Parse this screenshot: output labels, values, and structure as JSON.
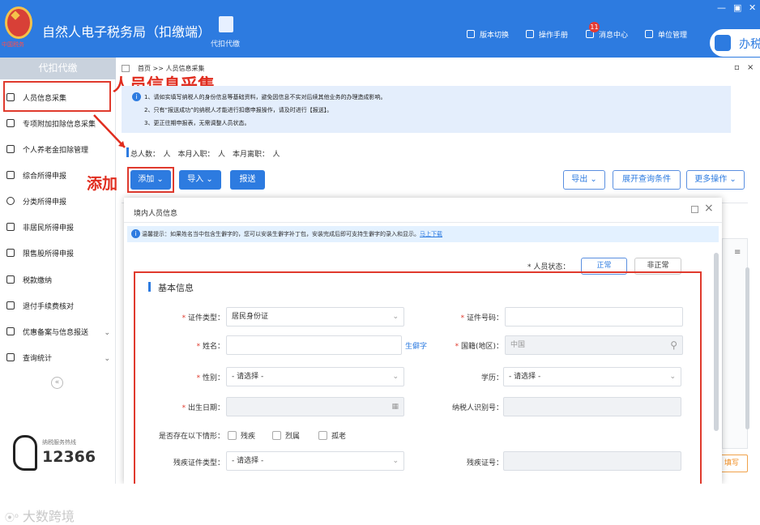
{
  "app": {
    "title": "自然人电子税务局（扣缴端）",
    "emblem_subtitle": "中国税务",
    "agent_tab": "代扣代缴",
    "nav": [
      "版本切换",
      "操作手册",
      "消息中心",
      "单位管理"
    ],
    "message_badge": "11",
    "window_controls": [
      "—",
      "▣",
      "✕"
    ],
    "office_label": "办税"
  },
  "sidebar": {
    "header": "代扣代缴",
    "items": [
      {
        "label": "人员信息采集",
        "icon": "person-icon"
      },
      {
        "label": "专项附加扣除信息采集",
        "icon": "list-icon"
      },
      {
        "label": "个人养老金扣除管理",
        "icon": "doc-icon"
      },
      {
        "label": "综合所得申报",
        "icon": "layers-icon"
      },
      {
        "label": "分类所得申报",
        "icon": "clock-icon"
      },
      {
        "label": "非居民所得申报",
        "icon": "user-icon"
      },
      {
        "label": "限售股所得申报",
        "icon": "bar-icon"
      },
      {
        "label": "税款缴纳",
        "icon": "folder-icon"
      },
      {
        "label": "退付手续费核对",
        "icon": "report-icon"
      },
      {
        "label": "优惠备案与信息报送",
        "icon": "file-icon"
      },
      {
        "label": "查询统计",
        "icon": "query-icon"
      }
    ],
    "collapse": "«",
    "hotline_label": "纳税服务热线",
    "hotline": "12366"
  },
  "main": {
    "breadcrumb": "首页 >> 人员信息采集",
    "controls": [
      "▫",
      "×"
    ],
    "notices": [
      "1、请如实填写纳税人的身份信息等基础资料，避免因信息不实对后续其他业务的办理造成影响。",
      "2、只有“报送成功”的纳税人才能进行扣缴申报操作，请及时进行【报送】。",
      "3、更正往期申报表，无需调整人员状态。"
    ],
    "summary": "总人数：　人　本月入职：　人　本月离职：　人",
    "buttons": {
      "add": "添加",
      "import": "导入",
      "submit": "报送",
      "export": "导出",
      "expand_query": "展开查询条件",
      "more": "更多操作"
    },
    "right_edge": [
      "≡",
      "填写"
    ]
  },
  "annotations": {
    "title": "人员信息采集",
    "add": "添加"
  },
  "modal": {
    "title": "境内人员信息",
    "tip": "温馨提示：如果姓名当中包含生僻字的，您可以安装生僻字补丁包，安装完成后即可支持生僻字的录入和显示。",
    "tip_link": "马上下载",
    "status_label": "* 人员状态：",
    "status_options": [
      "正常",
      "非正常"
    ],
    "section": "基本信息",
    "fields": {
      "id_type": {
        "label": "证件类型：",
        "value": "居民身份证"
      },
      "id_number": {
        "label": "证件号码：",
        "value": ""
      },
      "name": {
        "label": "姓名：",
        "value": ""
      },
      "rare_char": "生僻字",
      "nationality": {
        "label": "国籍(地区)：",
        "value": "中国"
      },
      "gender": {
        "label": "性别：",
        "value": "- 请选择 -"
      },
      "education": {
        "label": "学历：",
        "value": "- 请选择 -"
      },
      "birth": {
        "label": "出生日期：",
        "value": ""
      },
      "taxpayer_id": {
        "label": "纳税人识别号：",
        "value": ""
      },
      "situations_label": "是否存在以下情形：",
      "situations": [
        "残疾",
        "烈属",
        "孤老"
      ],
      "disability_type": {
        "label": "残疾证件类型：",
        "value": "- 请选择 -"
      },
      "disability_no": {
        "label": "残疾证号：",
        "value": ""
      }
    }
  },
  "watermark": "大数跨境"
}
